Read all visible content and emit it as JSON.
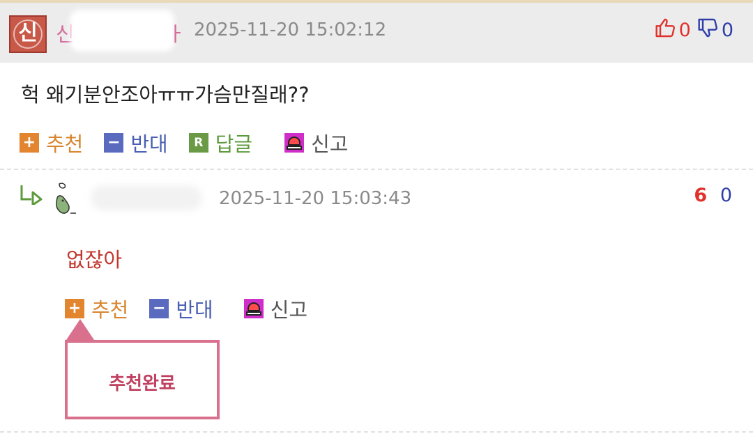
{
  "post": {
    "nickname_start": "신",
    "nickname_end": "ㅏ",
    "date": "2025-11-20 15:02:12",
    "upvotes": "0",
    "downvotes": "0",
    "text": "헉 왜기분안조아ㅠㅠ가슴만질래??",
    "avatar_text": "신"
  },
  "actions": {
    "recommend": "추천",
    "oppose": "반대",
    "reply": "답글",
    "reply_icon_letter": "R",
    "report": "신고",
    "plus_symbol": "+",
    "minus_symbol": "−"
  },
  "reply": {
    "date": "2025-11-20 15:03:43",
    "upvotes": "6",
    "downvotes": "0",
    "text": "없잖아"
  },
  "tooltip": {
    "text": "추천완료"
  },
  "colors": {
    "header_bg": "#ececec",
    "recommend": "#e3852f",
    "oppose": "#5a6abf",
    "reply": "#6a9a45",
    "report": "#cf2fc8",
    "upvote": "#e0322d",
    "downvote": "#2f3ea8",
    "tooltip_border": "#d8708e"
  }
}
